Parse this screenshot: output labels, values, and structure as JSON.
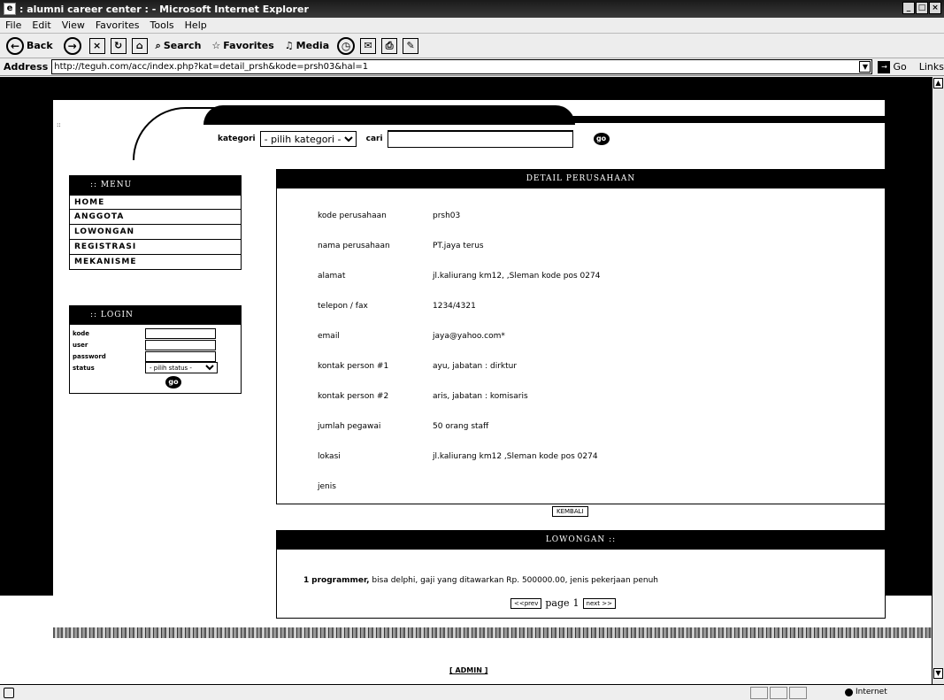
{
  "window": {
    "title": ": alumni career center : - Microsoft Internet Explorer",
    "minimize": "_",
    "maximize": "□",
    "close": "×"
  },
  "menu": [
    "File",
    "Edit",
    "View",
    "Favorites",
    "Tools",
    "Help"
  ],
  "toolbar": {
    "back": "Back",
    "search": "Search",
    "favorites": "Favorites",
    "media": "Media"
  },
  "address": {
    "label": "Address",
    "url": "http://teguh.com/acc/index.php?kat=detail_prsh&kode=prsh03&hal=1",
    "go": "Go",
    "links": "Links"
  },
  "header": {
    "small_text": "::",
    "kategori_label": "kategori",
    "kategori_selected": "- pilih kategori -",
    "cari_label": "cari",
    "go": "go"
  },
  "menu_panel": {
    "title": ":: MENU",
    "items": [
      "HOME",
      "ANGGOTA",
      "LOWONGAN",
      "REGISTRASI",
      "MEKANISME"
    ]
  },
  "login_panel": {
    "title": ":: LOGIN",
    "kode": "kode",
    "user": "user",
    "password": "password",
    "status": "status",
    "status_selected": "- pilih status -",
    "go": "go"
  },
  "detail": {
    "title": "DETAIL PERUSAHAAN",
    "rows": [
      {
        "k": "kode perusahaan",
        "v": "prsh03"
      },
      {
        "k": "nama perusahaan",
        "v": "PT.jaya terus"
      },
      {
        "k": "alamat",
        "v": "jl.kaliurang km12, ,Sleman kode pos 0274"
      },
      {
        "k": "telepon / fax",
        "v": "1234/4321"
      },
      {
        "k": "email",
        "v": "jaya@yahoo.com*"
      },
      {
        "k": "kontak person #1",
        "v": "ayu, jabatan : dirktur"
      },
      {
        "k": "kontak person #2",
        "v": "aris, jabatan : komisaris"
      },
      {
        "k": "jumlah pegawai",
        "v": "50 orang staff"
      },
      {
        "k": "lokasi",
        "v": "jl.kaliurang km12 ,Sleman kode pos 0274"
      },
      {
        "k": "jenis",
        "v": ""
      }
    ],
    "kembali": "KEMBALI"
  },
  "lowongan": {
    "title": "LOWONGAN ::",
    "item_no": "1",
    "item_title": "programmer,",
    "item_text": " bisa delphi, gaji yang ditawarkan Rp. 500000.00, jenis pekerjaan penuh",
    "prev": "<<prev",
    "page_label": "page",
    "page": "1",
    "next": "next >>"
  },
  "footer": {
    "admin": "[ ADMIN ]"
  },
  "status": {
    "zone": "Internet"
  }
}
